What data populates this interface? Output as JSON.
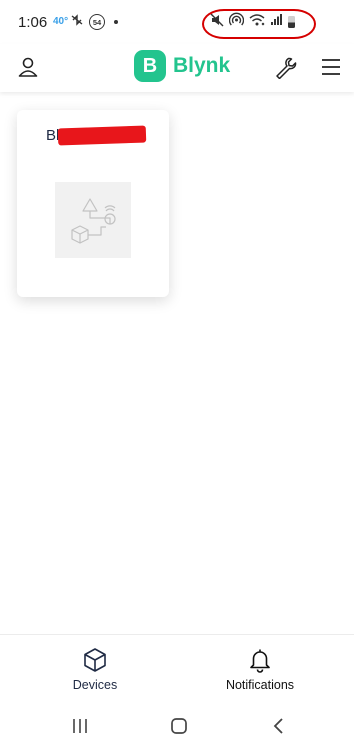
{
  "status_bar": {
    "time": "1:06",
    "temperature": "40°",
    "notification_count": "54",
    "icons": [
      "nfc-icon",
      "badge-54-icon",
      "dot-icon",
      "mute-icon",
      "hotspot-icon",
      "wifi-icon",
      "signal-icon",
      "battery-icon"
    ]
  },
  "app_bar": {
    "logo_letter": "B",
    "logo_text": "Blynk",
    "icons": [
      "user-icon",
      "wrench-icon",
      "menu-icon"
    ],
    "brand_color": "#23c48e"
  },
  "device_card": {
    "title": "Bl",
    "image_icon": "device-placeholder-icon"
  },
  "bottom_nav": {
    "items": [
      {
        "label": "Devices",
        "icon": "cube-icon"
      },
      {
        "label": "Notifications",
        "icon": "bell-icon"
      }
    ]
  },
  "system_nav": {
    "icons": [
      "recents-icon",
      "home-icon",
      "back-icon"
    ]
  },
  "annotation_color": "#d50000",
  "redaction_color": "#e8161b"
}
